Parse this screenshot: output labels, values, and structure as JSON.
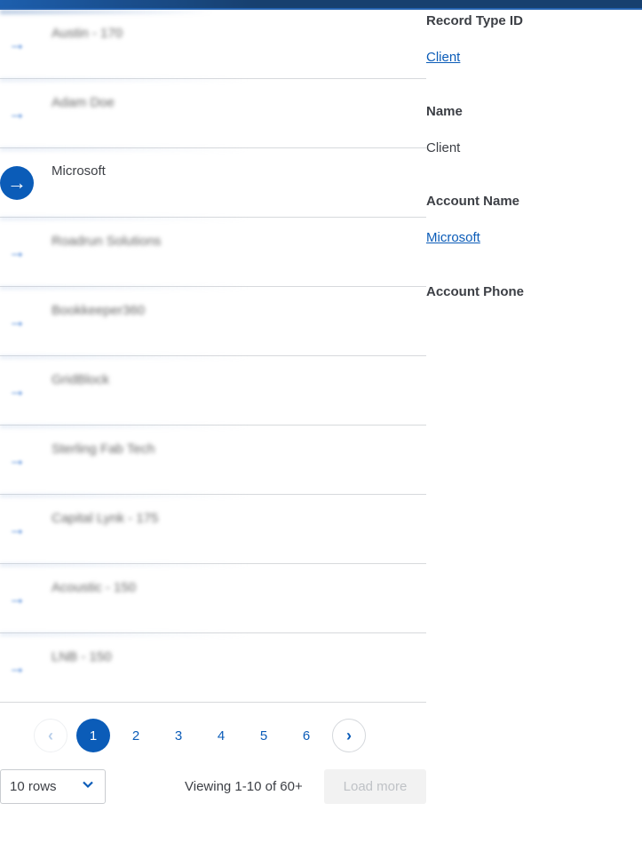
{
  "list": {
    "rows": [
      {
        "name": "Austin - 170",
        "selected": false
      },
      {
        "name": "Adam Doe",
        "selected": false
      },
      {
        "name": "Microsoft",
        "selected": true
      },
      {
        "name": "Roadrun Solutions",
        "selected": false
      },
      {
        "name": "Bookkeeper360",
        "selected": false
      },
      {
        "name": "GridBlock",
        "selected": false
      },
      {
        "name": "Sterling Fab Tech",
        "selected": false
      },
      {
        "name": "Capital Lynk - 175",
        "selected": false
      },
      {
        "name": "Acoustic - 150",
        "selected": false
      },
      {
        "name": "LNB - 150",
        "selected": false
      }
    ],
    "row_icon": "arrow-right-icon"
  },
  "pagination": {
    "prev_icon": "‹",
    "next_icon": "›",
    "pages": [
      "1",
      "2",
      "3",
      "4",
      "5",
      "6"
    ],
    "current_page": "1"
  },
  "footer": {
    "rows_select_value": "10 rows",
    "chevron_icon": "⌄",
    "viewing_text": "Viewing 1-10 of 60+",
    "load_more_label": "Load more"
  },
  "detail": {
    "fields": [
      {
        "label": "Record Type ID",
        "value": "Client",
        "link": true
      },
      {
        "label": "Name",
        "value": "Client",
        "link": false
      },
      {
        "label": "Account Name",
        "value": "Microsoft",
        "link": true
      },
      {
        "label": "Account Phone",
        "value": "",
        "link": false
      }
    ]
  },
  "colors": {
    "accent": "#0b5cb8",
    "header": "#17406f",
    "text": "#3c3f45",
    "divider": "#d7d9dc",
    "disabled_bg": "#f2f2f2"
  }
}
